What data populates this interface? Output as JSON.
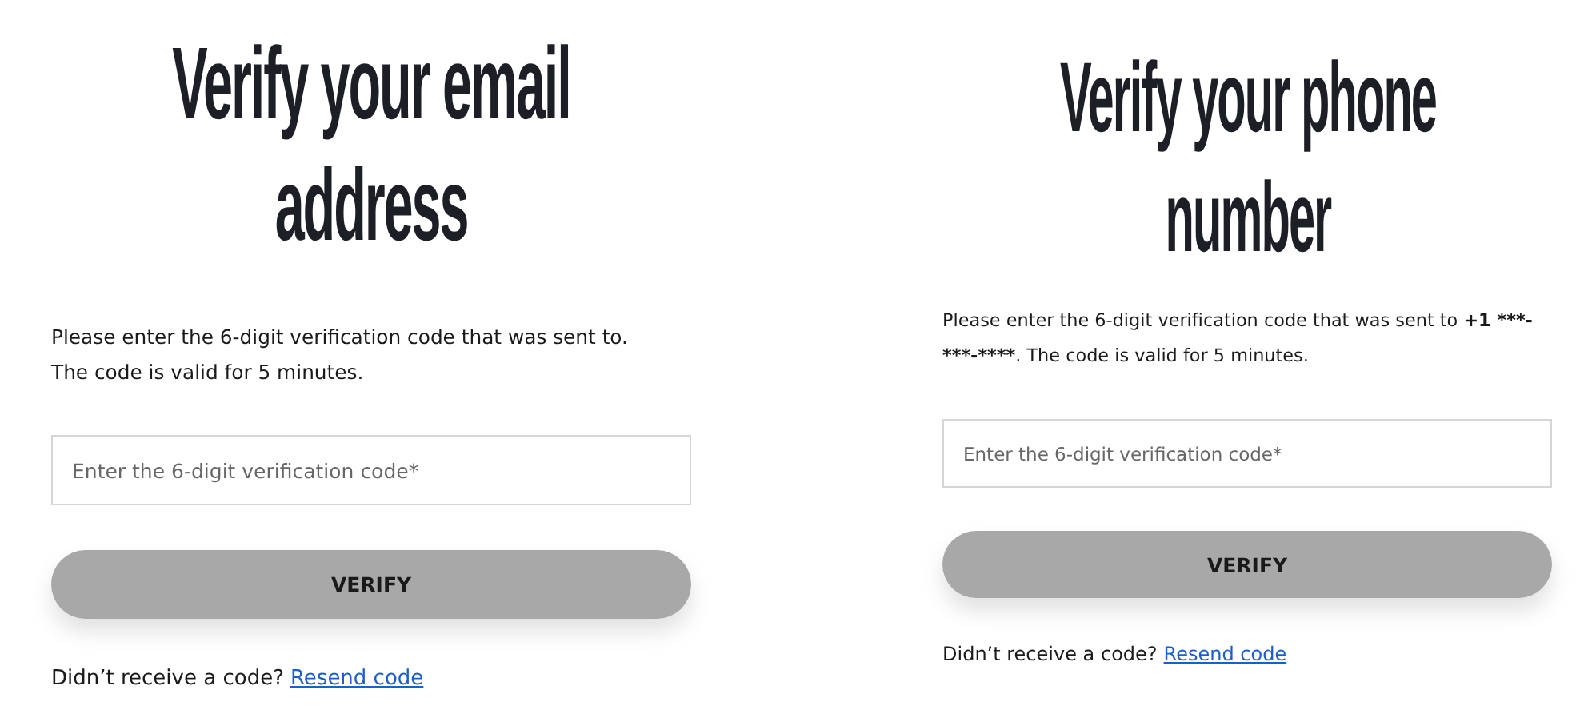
{
  "panels": [
    {
      "title": "Verify your email address",
      "message": [
        {
          "text": "Please enter the 6-digit verification code that was sent to.\nThe code is valid for 5 minutes.",
          "bold": false
        }
      ],
      "code_field": {
        "placeholder": "Enter the 6-digit verification code*"
      },
      "verify_button": {
        "label": "VERIFY",
        "disabled": true
      },
      "resend": {
        "text": "Didn’t receive a code?",
        "link": "Resend code"
      }
    },
    {
      "title": "Verify your phone number",
      "message": [
        {
          "text": "Please enter the 6-digit verification code that was sent to ",
          "bold": false
        },
        {
          "text": "+1 ***-***-****",
          "bold": true
        },
        {
          "text": ". The code is valid for 5 minutes.",
          "bold": false
        }
      ],
      "code_field": {
        "placeholder": "Enter the 6-digit verification code*"
      },
      "verify_button": {
        "label": "VERIFY",
        "disabled": true
      },
      "resend": {
        "text": "Didn’t receive a code?",
        "link": "Resend code"
      }
    }
  ]
}
